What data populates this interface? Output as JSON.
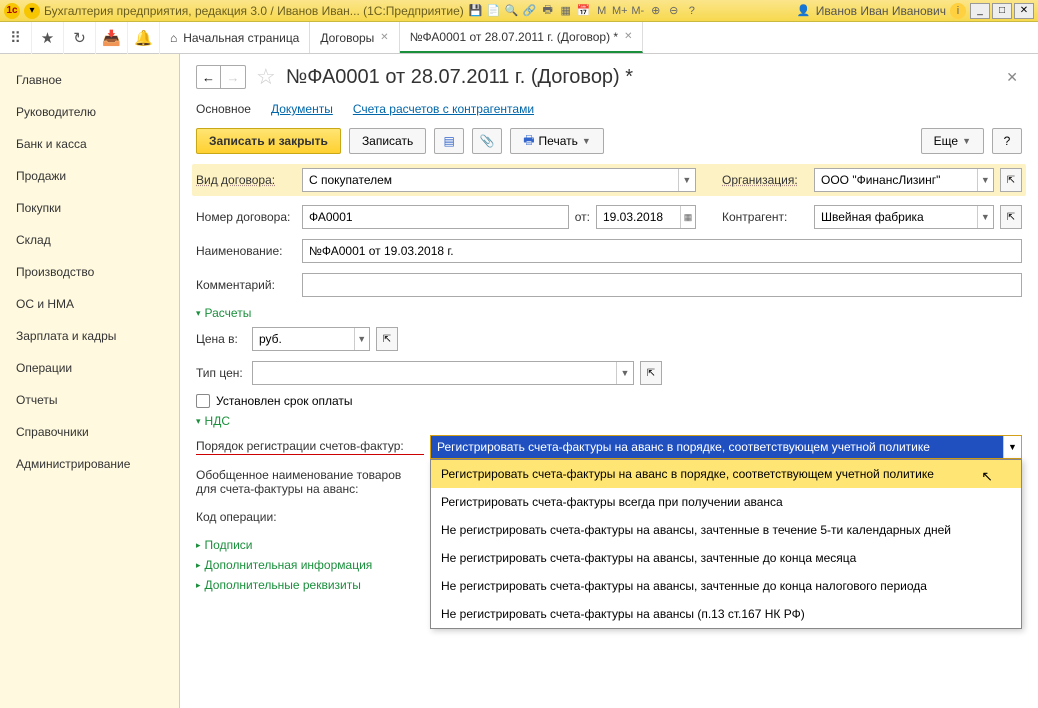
{
  "title": "Бухгалтерия предприятия, редакция 3.0 / Иванов Иван...  (1С:Предприятие)",
  "user": "Иванов Иван Иванович",
  "toolbar_tabs": {
    "home": "Начальная страница",
    "t1": "Договоры",
    "t2": "№ФА0001 от 28.07.2011 г. (Договор) *"
  },
  "sidebar": [
    "Главное",
    "Руководителю",
    "Банк и касса",
    "Продажи",
    "Покупки",
    "Склад",
    "Производство",
    "ОС и НМА",
    "Зарплата и кадры",
    "Операции",
    "Отчеты",
    "Справочники",
    "Администрирование"
  ],
  "page": {
    "title": "№ФА0001 от 28.07.2011 г. (Договор) *",
    "subtabs": {
      "a": "Основное",
      "b": "Документы",
      "c": "Счета расчетов с контрагентами"
    },
    "buttons": {
      "save_close": "Записать и закрыть",
      "save": "Записать",
      "print": "Печать",
      "more": "Еще",
      "help": "?"
    },
    "labels": {
      "contract_type": "Вид договора:",
      "org": "Организация:",
      "number": "Номер договора:",
      "from": "от:",
      "contragent": "Контрагент:",
      "name": "Наименование:",
      "comment": "Комментарий:",
      "calc": "Расчеты",
      "price_in": "Цена в:",
      "price_type": "Тип цен:",
      "term": "Установлен срок оплаты",
      "vat": "НДС",
      "invoice_order": "Порядок регистрации счетов-фактур:",
      "gen_name1": "Обобщенное наименование товаров",
      "gen_name2": "для счета-фактуры на аванс:",
      "op_code": "Код операции:",
      "sign": "Подписи",
      "addinfo": "Дополнительная информация",
      "addreq": "Дополнительные реквизиты"
    },
    "values": {
      "contract_type": "С покупателем",
      "org": "ООО \"ФинансЛизинг\"",
      "number": "ФА0001",
      "date": "19.03.2018",
      "contragent": "Швейная фабрика",
      "name": "№ФА0001 от 19.03.2018 г.",
      "currency": "руб.",
      "invoice_selected": "Регистрировать счета-фактуры на аванс в порядке, соответствующем учетной политике"
    },
    "dropdown_options": [
      "Регистрировать счета-фактуры на аванс в порядке, соответствующем учетной политике",
      "Регистрировать счета-фактуры всегда при получении аванса",
      "Не регистрировать счета-фактуры на авансы, зачтенные в течение 5-ти календарных дней",
      "Не регистрировать счета-фактуры на авансы, зачтенные до конца месяца",
      "Не регистрировать счета-фактуры на авансы, зачтенные до конца налогового периода",
      "Не регистрировать счета-фактуры на авансы (п.13 ст.167 НК РФ)"
    ]
  }
}
